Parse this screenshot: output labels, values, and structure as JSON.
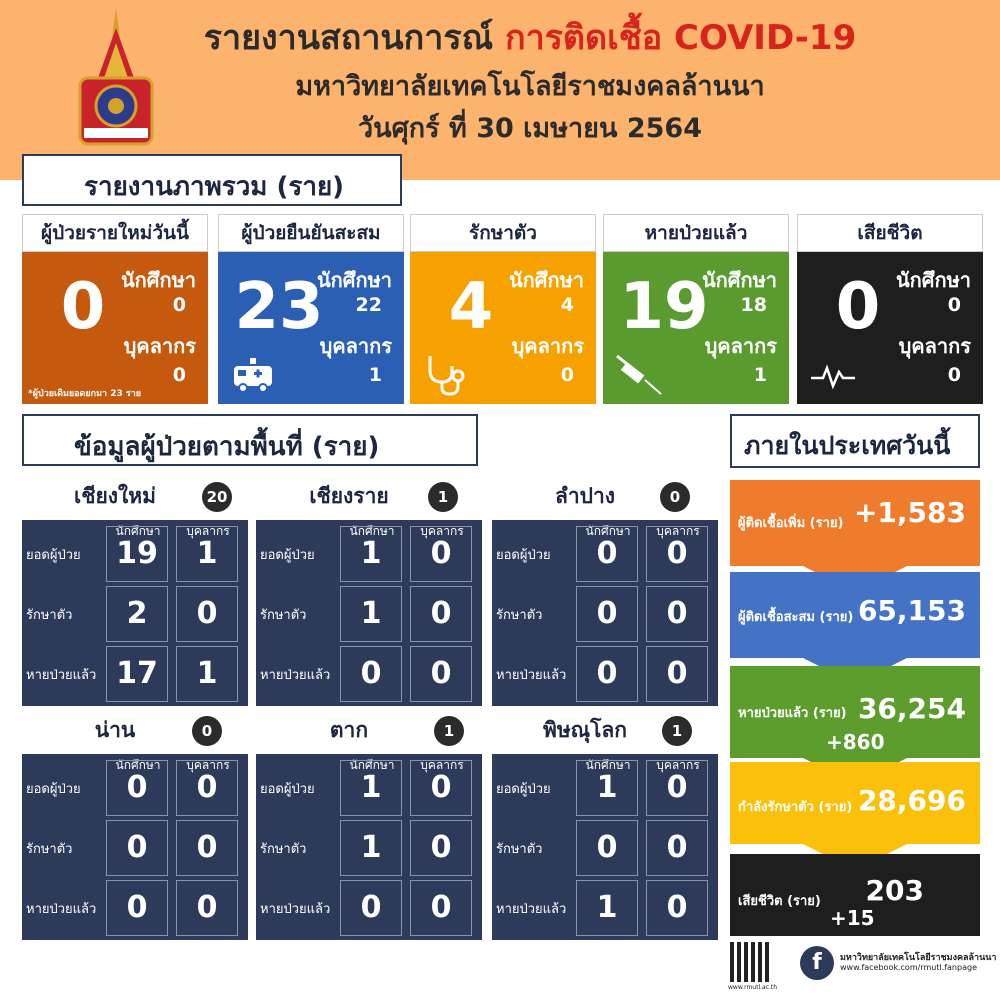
{
  "header": {
    "title_main": "รายงานสถานการณ์",
    "title_highlight": "การติดเชื้อ COVID-19",
    "university": "มหาวิทยาลัยเทคโนโลยีราชมงคลล้านนา",
    "date": "วันศุกร์ ที่ 30 เมษายน 2564"
  },
  "overview": {
    "title": "รายงานภาพรวม (ราย)",
    "student_label": "นักศึกษา",
    "staff_label": "บุคลากร",
    "cards": [
      {
        "label": "ผู้ป่วยรายใหม่วันนี้",
        "total": "0",
        "students": "0",
        "staff": "0",
        "note": "*ผู้ป่วยเดิมยอดยกมา 23 ราย",
        "color": "#c5590d"
      },
      {
        "label": "ผู้ป่วยยืนยันสะสม",
        "total": "23",
        "students": "22",
        "staff": "1",
        "icon": "ambulance-icon",
        "color": "#2b5fb3"
      },
      {
        "label": "รักษาตัว",
        "total": "4",
        "students": "4",
        "staff": "0",
        "icon": "stethoscope-icon",
        "color": "#f7a100"
      },
      {
        "label": "หายป่วยแล้ว",
        "total": "19",
        "students": "18",
        "staff": "1",
        "icon": "syringe-icon",
        "color": "#5a9b2f"
      },
      {
        "label": "เสียชีวิต",
        "total": "0",
        "students": "0",
        "staff": "0",
        "icon": "heartbeat-icon",
        "color": "#1e1e1e"
      }
    ]
  },
  "areas": {
    "title": "ข้อมูลผู้ป่วยตามพื้นที่ (ราย)",
    "col_student": "นักศึกษา",
    "col_staff": "บุคลากร",
    "row_total": "ยอดผู้ป่วย",
    "row_treat": "รักษาตัว",
    "row_recovered": "หายป่วยแล้ว",
    "regions": [
      {
        "name": "เชียงใหม่",
        "badge": "20",
        "total": [
          "19",
          "1"
        ],
        "treat": [
          "2",
          "0"
        ],
        "recovered": [
          "17",
          "1"
        ]
      },
      {
        "name": "เชียงราย",
        "badge": "1",
        "total": [
          "1",
          "0"
        ],
        "treat": [
          "1",
          "0"
        ],
        "recovered": [
          "0",
          "0"
        ]
      },
      {
        "name": "ลำปาง",
        "badge": "0",
        "total": [
          "0",
          "0"
        ],
        "treat": [
          "0",
          "0"
        ],
        "recovered": [
          "0",
          "0"
        ]
      },
      {
        "name": "น่าน",
        "badge": "0",
        "total": [
          "0",
          "0"
        ],
        "treat": [
          "0",
          "0"
        ],
        "recovered": [
          "0",
          "0"
        ]
      },
      {
        "name": "ตาก",
        "badge": "1",
        "total": [
          "1",
          "0"
        ],
        "treat": [
          "1",
          "0"
        ],
        "recovered": [
          "0",
          "0"
        ]
      },
      {
        "name": "พิษณุโลก",
        "badge": "1",
        "total": [
          "1",
          "0"
        ],
        "treat": [
          "0",
          "0"
        ],
        "recovered": [
          "1",
          "0"
        ]
      }
    ]
  },
  "national": {
    "title": "ภายในประเทศวันนี้",
    "new_cases_label": "ผู้ติดเชื้อเพิ่ม (ราย)",
    "new_cases": "+1,583",
    "cumulative_label": "ผู้ติดเชื้อสะสม (ราย)",
    "cumulative": "65,153",
    "recovered_label": "หายป่วยแล้ว (ราย)",
    "recovered": "36,254",
    "recovered_inc": "+860",
    "treating_label": "กำลังรักษาตัว (ราย)",
    "treating": "28,696",
    "deaths_label": "เสียชีวิต (ราย)",
    "deaths": "203",
    "deaths_inc": "+15",
    "colors": {
      "orange": "#ef7c2d",
      "blue": "#4472c4",
      "green": "#5d9d2d",
      "yellow": "#fbc10a",
      "black": "#1e1e1e"
    }
  },
  "footer": {
    "university": "มหาวิทยาลัยเทคโนโลยีราชมงคลล้านนา",
    "facebook": "www.facebook.com/rmutl.fanpage",
    "qr_caption": "www.rmutl.ac.th",
    "icon": "facebook-icon"
  }
}
